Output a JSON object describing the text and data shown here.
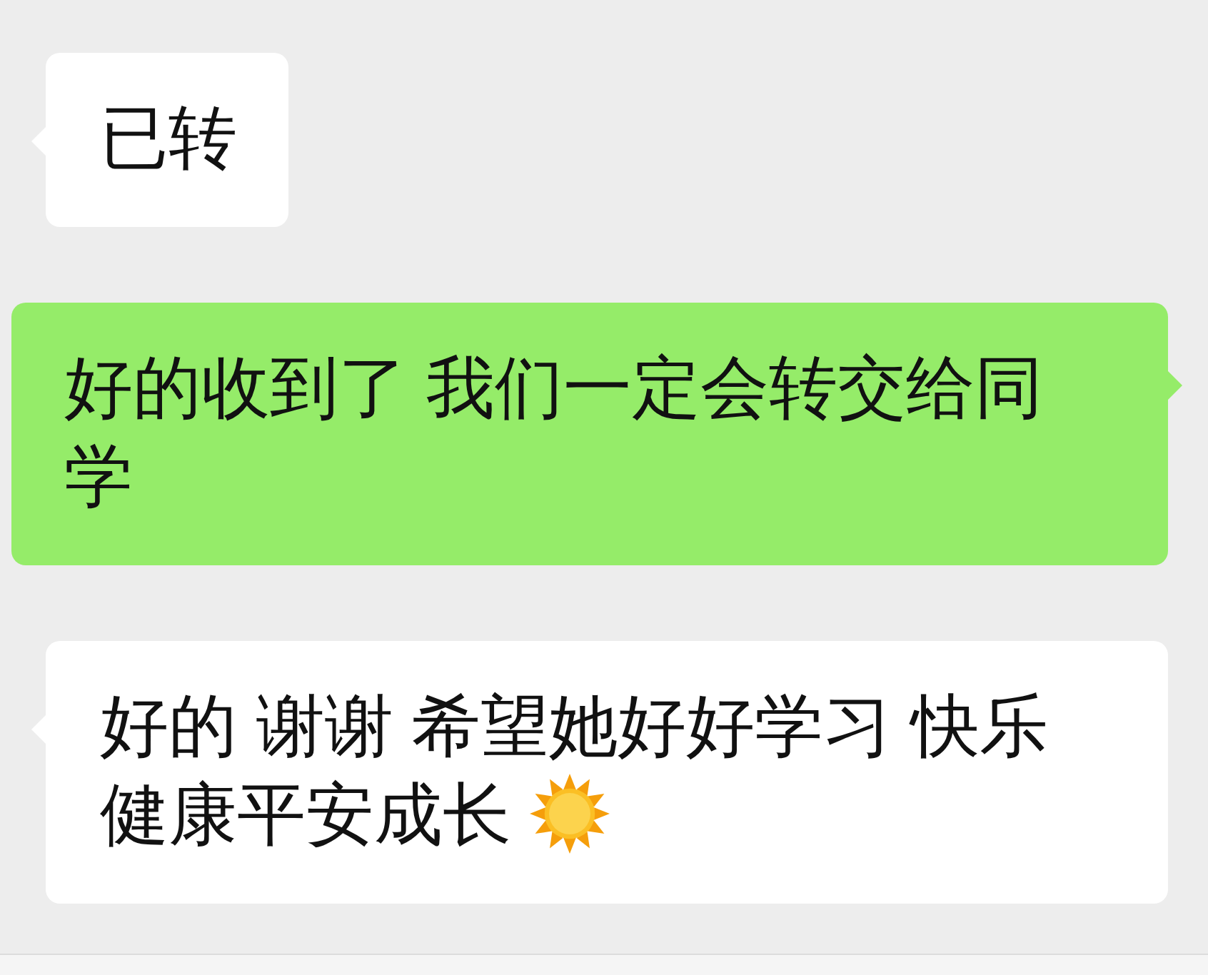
{
  "messages": [
    {
      "kind": "received",
      "text": "已转",
      "sun_emoji": false
    },
    {
      "kind": "sent",
      "text": "好的收到了 我们一定会转交给同学",
      "sun_emoji": false
    },
    {
      "kind": "received",
      "text": "好的 谢谢 希望她好好学习 快乐健康平安成长",
      "sun_emoji": true
    }
  ]
}
